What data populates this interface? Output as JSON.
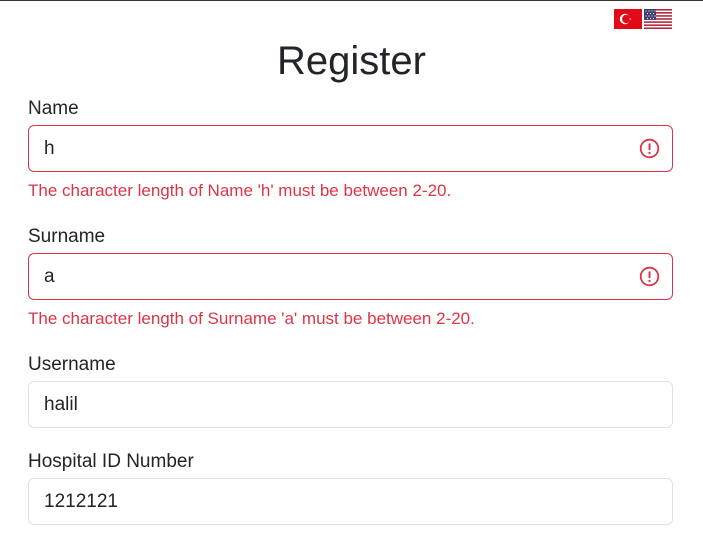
{
  "language": {
    "options": [
      {
        "code": "tr",
        "name": "Turkish flag"
      },
      {
        "code": "en",
        "name": "US flag"
      }
    ]
  },
  "form": {
    "title": "Register",
    "fields": {
      "name": {
        "label": "Name",
        "value": "h",
        "error": "The character length of Name 'h' must be between 2-20.",
        "invalid": true
      },
      "surname": {
        "label": "Surname",
        "value": "a",
        "error": "The character length of Surname 'a' must be between 2-20.",
        "invalid": true
      },
      "username": {
        "label": "Username",
        "value": "halil"
      },
      "hospital_id": {
        "label": "Hospital ID Number",
        "value": "1212121"
      }
    }
  },
  "colors": {
    "error": "#dc3545",
    "border": "#dee2e6",
    "text": "#212529"
  }
}
